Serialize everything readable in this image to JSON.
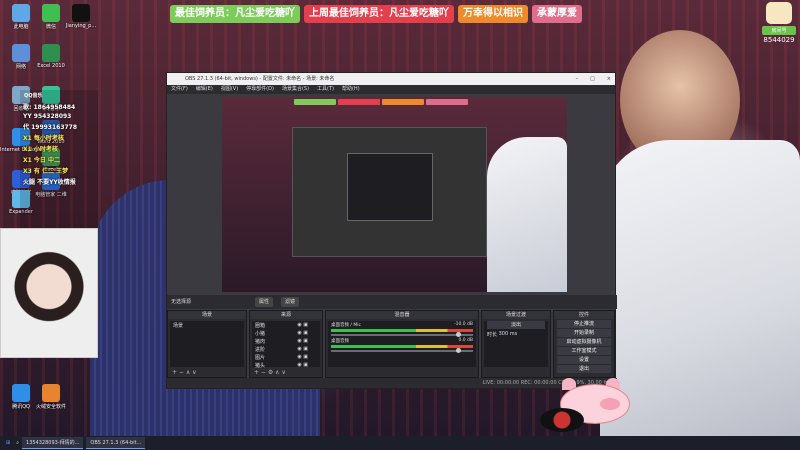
{
  "desktop": {
    "icons": [
      {
        "label": "此电脑",
        "color": "#5fa8e8"
      },
      {
        "label": "微信",
        "color": "#3fbf4f"
      },
      {
        "label": "Jianying_p...",
        "color": "#111111"
      },
      {
        "label": "网络",
        "color": "#5f8fd8"
      },
      {
        "label": "Excel 2010",
        "color": "#2f8f4f"
      },
      {
        "label": "回收站",
        "color": "#7fa8c8"
      },
      {
        "label": "QQ音乐",
        "color": "#34c39a"
      },
      {
        "label": "Word 2010",
        "color": "#2f5fb8"
      },
      {
        "label": "Internet Explorer",
        "color": "#2f8fe8"
      },
      {
        "label": "Excel",
        "color": "#3f9f5f"
      },
      {
        "label": "电脑管家",
        "color": "#2f5fd8"
      },
      {
        "label": "Expander",
        "color": "#5fb8e8"
      },
      {
        "label": "电脑管家 二维",
        "color": "#2f6fd8"
      },
      {
        "label": "腾讯QQ",
        "color": "#2f8fe8"
      },
      {
        "label": "火绒安全软件",
        "color": "#e8842f"
      }
    ]
  },
  "banner": {
    "items": [
      {
        "text": "最佳饲养员：凡尘爱吃糖吖",
        "color": "#7dcc5a"
      },
      {
        "text": "上周最佳饲养员：凡尘爱吃糖吖",
        "color": "#e33f4d"
      },
      {
        "text": "万幸得以相识",
        "color": "#ef8a2a"
      },
      {
        "text": "承蒙厚爱",
        "color": "#e06d8c"
      }
    ]
  },
  "streamer": {
    "tag": "房间号",
    "id": "8544029"
  },
  "qq_overlay": {
    "title": "QQ音乐",
    "lines": [
      {
        "text": "歌: 1864958484",
        "hl": false
      },
      {
        "text": "YY 954328093",
        "hl": false
      },
      {
        "text": "代 19993163778",
        "hl": false
      },
      {
        "text": "X1 每小时考核",
        "hl": true
      },
      {
        "text": "X1 小时考核",
        "hl": true
      },
      {
        "text": "X1 今日 中二",
        "hl": true
      },
      {
        "text": "X3 有 仁二 王梦",
        "hl": true
      },
      {
        "text": "火腿 不要YY收情报",
        "hl": false
      }
    ]
  },
  "obs": {
    "title": "OBS 27.1.3 (64-bit, windows) - 配置文件: 未命名 - 场景: 未命名",
    "menu": [
      "文件(F)",
      "编辑(E)",
      "视图(V)",
      "停靠部件(D)",
      "场景集合(S)",
      "工具(T)",
      "帮助(H)"
    ],
    "controls_bar": {
      "label": "无选择源",
      "props": "属性",
      "filters": "滤镜"
    },
    "docks": {
      "scenes": {
        "title": "场景",
        "items": [
          "场景"
        ]
      },
      "sources": {
        "title": "来源",
        "items": [
          "圈箱",
          "小猪",
          "猪肉",
          "进阶",
          "图片",
          "猪头"
        ]
      },
      "mixer": {
        "title": "混音器",
        "tracks": [
          {
            "name": "桌面音频 / Mic",
            "db": "-10.0 dB"
          },
          {
            "name": "桌面音频",
            "db": "0.0 dB"
          }
        ]
      },
      "transitions": {
        "title": "场景过渡",
        "type": "淡出",
        "duration_label": "时长",
        "duration": "300 ms"
      },
      "controls": {
        "title": "控件",
        "buttons": [
          "停止推流",
          "开始录制",
          "启动虚拟摄像机",
          "工作室模式",
          "设置",
          "退出"
        ]
      }
    },
    "status": "LIVE: 00:00:00  REC: 00:00:00  CPU: 1.9%, 30.00 fps"
  },
  "taskbar": {
    "items": [
      "1354328093-拜情的...",
      "OBS 27.1.3 (64-bit..."
    ]
  }
}
